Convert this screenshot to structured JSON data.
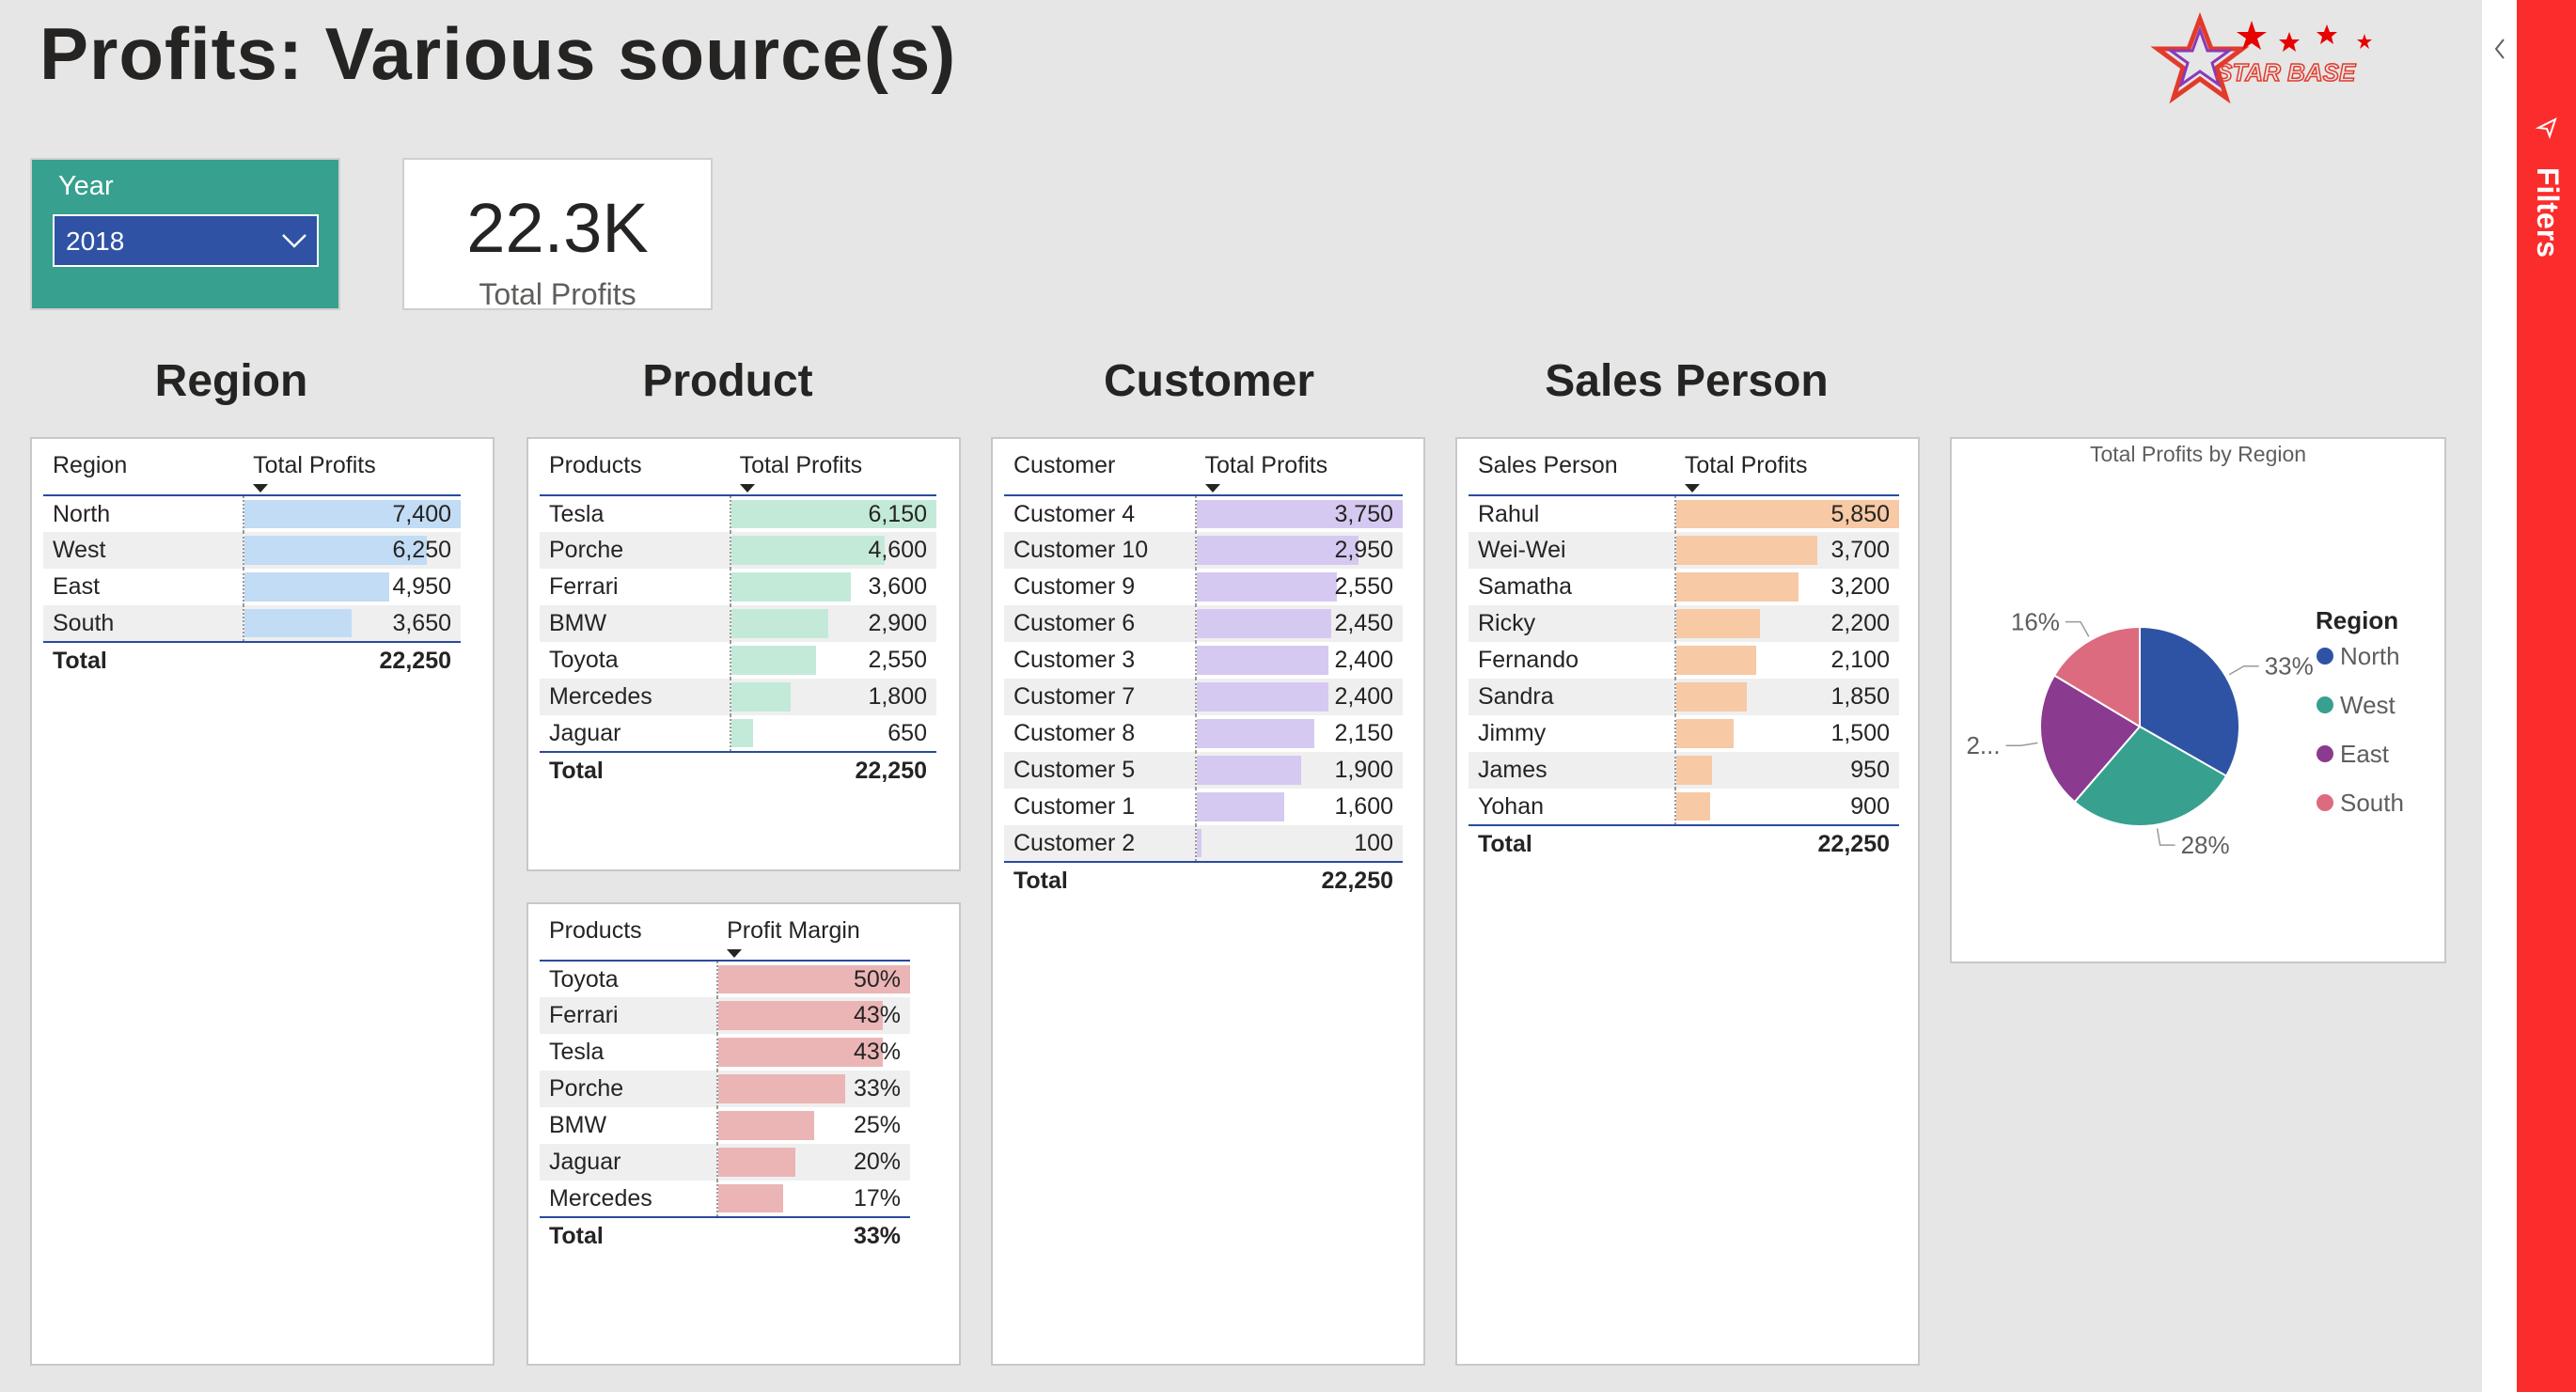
{
  "title": "Profits: Various source(s)",
  "logo_text": "STAR BASE",
  "slicer": {
    "label": "Year",
    "value": "2018"
  },
  "card": {
    "value": "22.3K",
    "caption": "Total Profits"
  },
  "sections": {
    "region": "Region",
    "product": "Product",
    "customer": "Customer",
    "sales_person": "Sales Person"
  },
  "region_table": {
    "headers": [
      "Region",
      "Total Profits"
    ],
    "bar_color": "#c1dcf4",
    "rows": [
      [
        "North",
        "7,400",
        7400
      ],
      [
        "West",
        "6,250",
        6250
      ],
      [
        "East",
        "4,950",
        4950
      ],
      [
        "South",
        "3,650",
        3650
      ]
    ],
    "total_label": "Total",
    "total_value": "22,250"
  },
  "product_table": {
    "headers": [
      "Products",
      "Total Profits"
    ],
    "bar_color": "#c3ead8",
    "rows": [
      [
        "Tesla",
        "6,150",
        6150
      ],
      [
        "Porche",
        "4,600",
        4600
      ],
      [
        "Ferrari",
        "3,600",
        3600
      ],
      [
        "BMW",
        "2,900",
        2900
      ],
      [
        "Toyota",
        "2,550",
        2550
      ],
      [
        "Mercedes",
        "1,800",
        1800
      ],
      [
        "Jaguar",
        "650",
        650
      ]
    ],
    "total_label": "Total",
    "total_value": "22,250"
  },
  "margin_table": {
    "headers": [
      "Products",
      "Profit Margin"
    ],
    "bar_color": "#ebb5b5",
    "rows": [
      [
        "Toyota",
        "50%",
        50
      ],
      [
        "Ferrari",
        "43%",
        43
      ],
      [
        "Tesla",
        "43%",
        43
      ],
      [
        "Porche",
        "33%",
        33
      ],
      [
        "BMW",
        "25%",
        25
      ],
      [
        "Jaguar",
        "20%",
        20
      ],
      [
        "Mercedes",
        "17%",
        17
      ]
    ],
    "total_label": "Total",
    "total_value": "33%"
  },
  "customer_table": {
    "headers": [
      "Customer",
      "Total Profits"
    ],
    "bar_color": "#d6c9f1",
    "rows": [
      [
        "Customer 4",
        "3,750",
        3750
      ],
      [
        "Customer 10",
        "2,950",
        2950
      ],
      [
        "Customer 9",
        "2,550",
        2550
      ],
      [
        "Customer 6",
        "2,450",
        2450
      ],
      [
        "Customer 3",
        "2,400",
        2400
      ],
      [
        "Customer 7",
        "2,400",
        2400
      ],
      [
        "Customer 8",
        "2,150",
        2150
      ],
      [
        "Customer 5",
        "1,900",
        1900
      ],
      [
        "Customer 1",
        "1,600",
        1600
      ],
      [
        "Customer 2",
        "100",
        100
      ]
    ],
    "total_label": "Total",
    "total_value": "22,250"
  },
  "salesperson_table": {
    "headers": [
      "Sales Person",
      "Total Profits"
    ],
    "bar_color": "#f7c9a5",
    "rows": [
      [
        "Rahul",
        "5,850",
        5850
      ],
      [
        "Wei-Wei",
        "3,700",
        3700
      ],
      [
        "Samatha",
        "3,200",
        3200
      ],
      [
        "Ricky",
        "2,200",
        2200
      ],
      [
        "Fernando",
        "2,100",
        2100
      ],
      [
        "Sandra",
        "1,850",
        1850
      ],
      [
        "Jimmy",
        "1,500",
        1500
      ],
      [
        "James",
        "950",
        950
      ],
      [
        "Yohan",
        "900",
        900
      ]
    ],
    "total_label": "Total",
    "total_value": "22,250"
  },
  "chart_data": {
    "type": "pie",
    "title": "Total Profits by Region",
    "legend_title": "Region",
    "legend_position": "right",
    "categories": [
      "North",
      "West",
      "East",
      "South"
    ],
    "values": [
      7400,
      6250,
      4950,
      3650
    ],
    "colors": [
      "#2e53a5",
      "#37a08f",
      "#8a3a8f",
      "#dd6b7f"
    ],
    "data_labels": [
      "33%",
      "28%",
      "2...",
      "16%"
    ]
  },
  "filters_pane": {
    "label": "Filters"
  }
}
